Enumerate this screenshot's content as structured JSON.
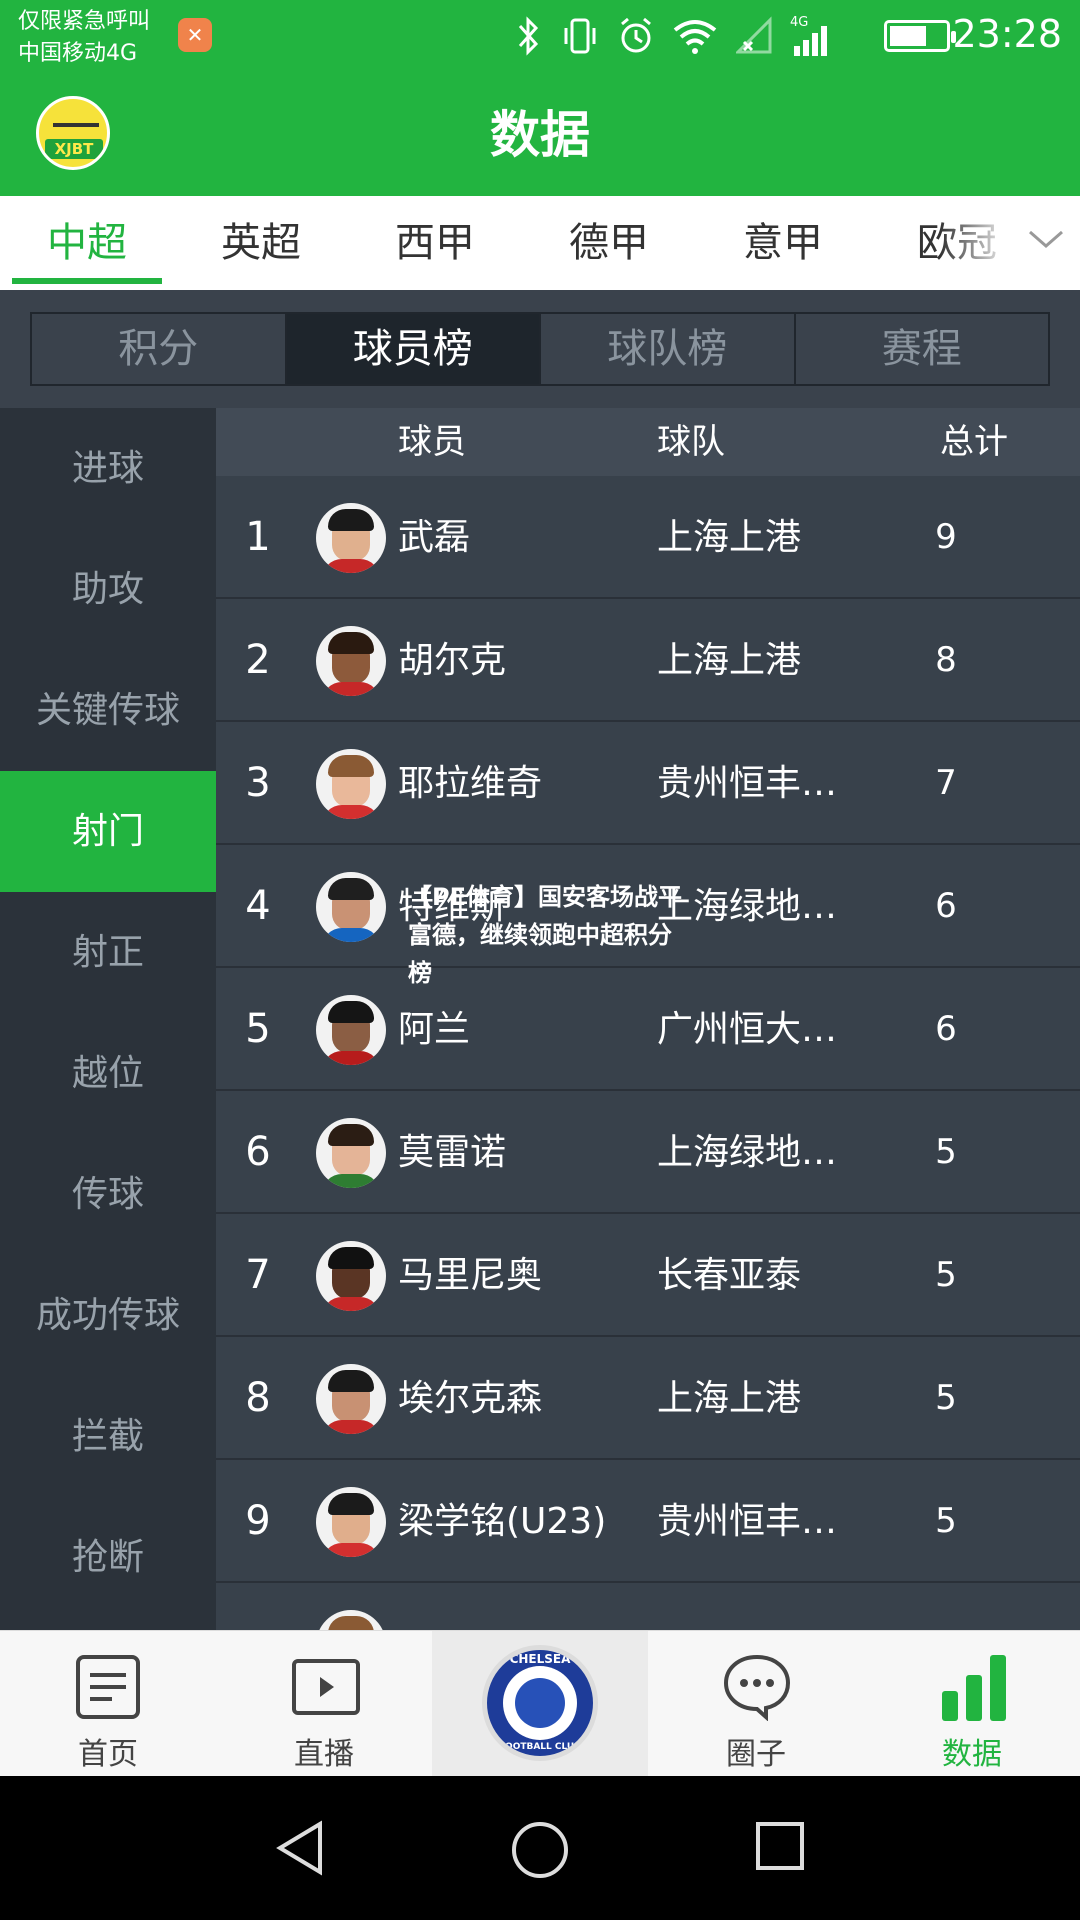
{
  "status_bar": {
    "carrier_line1": "仅限紧急呼叫",
    "carrier_line2": "中国移动4G",
    "network": "4G",
    "time": "23:28",
    "icons": [
      "app-icon",
      "bluetooth-icon",
      "vibrate-icon",
      "alarm-icon",
      "wifi-icon",
      "no-signal-icon",
      "signal-icon",
      "battery-charging-icon"
    ]
  },
  "header": {
    "title": "数据",
    "avatar_badge": "XJBT"
  },
  "league_tabs": [
    {
      "label": "中超",
      "active": true
    },
    {
      "label": "英超"
    },
    {
      "label": "西甲"
    },
    {
      "label": "德甲"
    },
    {
      "label": "意甲"
    },
    {
      "label": "欧冠"
    }
  ],
  "segments": [
    {
      "label": "积分"
    },
    {
      "label": "球员榜",
      "active": true
    },
    {
      "label": "球队榜"
    },
    {
      "label": "赛程"
    }
  ],
  "categories": [
    {
      "label": "进球"
    },
    {
      "label": "助攻"
    },
    {
      "label": "关键传球"
    },
    {
      "label": "射门",
      "active": true
    },
    {
      "label": "射正"
    },
    {
      "label": "越位"
    },
    {
      "label": "传球"
    },
    {
      "label": "成功传球"
    },
    {
      "label": "拦截"
    },
    {
      "label": "抢断"
    }
  ],
  "table": {
    "headers": {
      "player": "球员",
      "team": "球队",
      "total": "总计"
    },
    "rows": [
      {
        "rank": "1",
        "name": "武磊",
        "team": "上海上港",
        "total": "9"
      },
      {
        "rank": "2",
        "name": "胡尔克",
        "team": "上海上港",
        "total": "8"
      },
      {
        "rank": "3",
        "name": "耶拉维奇",
        "team": "贵州恒丰…",
        "total": "7"
      },
      {
        "rank": "4",
        "name": "特维斯",
        "team": "上海绿地…",
        "total": "6"
      },
      {
        "rank": "5",
        "name": "阿兰",
        "team": "广州恒大…",
        "total": "6"
      },
      {
        "rank": "6",
        "name": "莫雷诺",
        "team": "上海绿地…",
        "total": "5"
      },
      {
        "rank": "7",
        "name": "马里尼奥",
        "team": "长春亚泰",
        "total": "5"
      },
      {
        "rank": "8",
        "name": "埃尔克森",
        "team": "上海上港",
        "total": "5"
      },
      {
        "rank": "9",
        "name": "梁学铭(U23)",
        "team": "贵州恒丰…",
        "total": "5"
      }
    ]
  },
  "overlay_text": "【PE体育】国安客场战平富德，继续领跑中超积分榜",
  "bottom_nav": [
    {
      "label": "首页"
    },
    {
      "label": "直播"
    },
    {
      "label": "",
      "center_logo": {
        "top": "CHELSEA",
        "bottom": "FOOTBALL CLUB"
      }
    },
    {
      "label": "圈子"
    },
    {
      "label": "数据",
      "active": true
    }
  ],
  "colors": {
    "brand_green": "#22b440",
    "panel_dark": "#2b323a",
    "table_bg": "#38414b",
    "header_bg": "#424b56"
  }
}
